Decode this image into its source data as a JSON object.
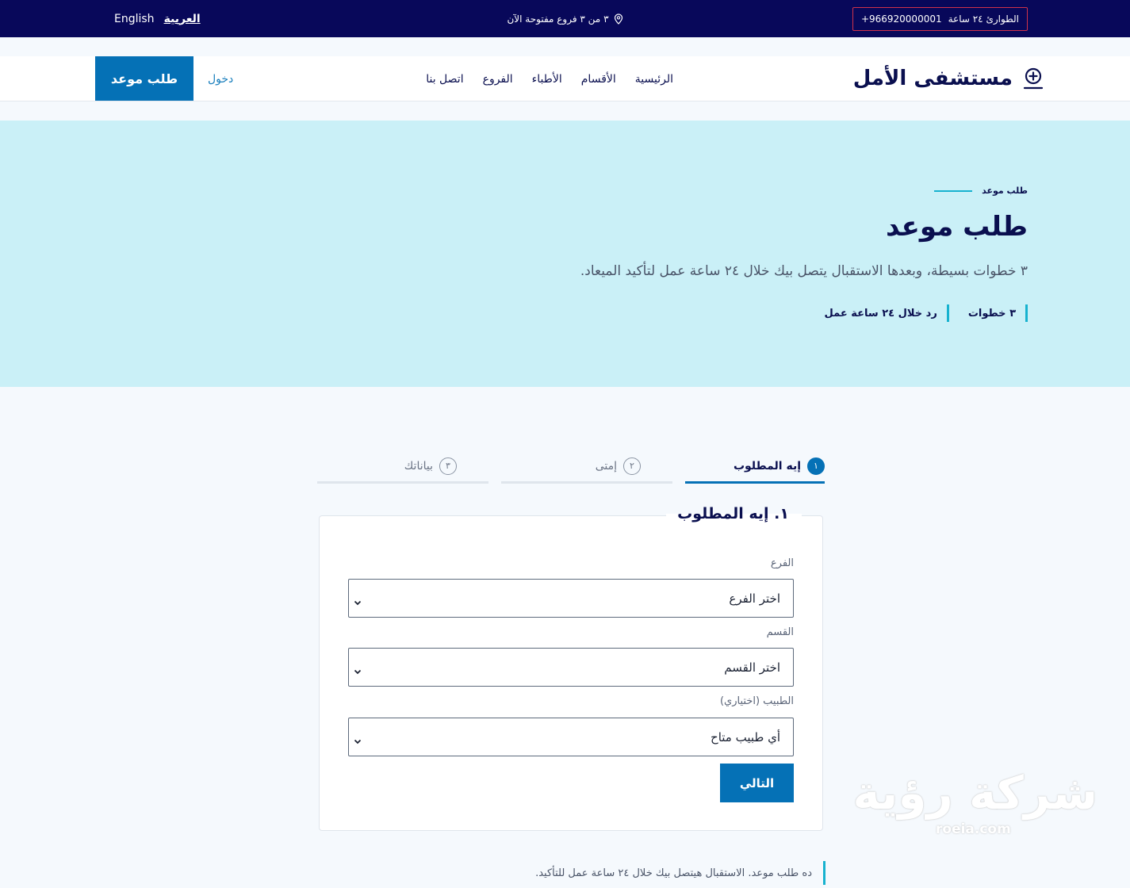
{
  "topbar": {
    "emergency_label": "الطوارئ ٢٤ ساعة",
    "emergency_phone": "+966920000001",
    "branches_status": "٣ من ٣ فروع مفتوحة الآن",
    "lang_en": "English",
    "lang_ar": "العربية"
  },
  "header": {
    "logo_name": "مستشفى الأمل",
    "nav": [
      "الرئيسية",
      "الأقسام",
      "الأطباء",
      "الفروع",
      "اتصل بنا"
    ],
    "login": "دخول",
    "book_button": "طلب موعد"
  },
  "hero": {
    "eyebrow": "طلب موعد",
    "title": "طلب موعد",
    "subtitle": "٣ خطوات بسيطة، وبعدها الاستقبال يتصل بيك خلال ٢٤ ساعة عمل لتأكيد الميعاد.",
    "stats": [
      "٣ خطوات",
      "رد خلال ٢٤ ساعة عمل"
    ]
  },
  "steps": [
    {
      "num": "١",
      "label": "إيه المطلوب",
      "active": true
    },
    {
      "num": "٢",
      "label": "إمتى",
      "active": false
    },
    {
      "num": "٣",
      "label": "بياناتك",
      "active": false
    }
  ],
  "form": {
    "legend": "١. إيه المطلوب",
    "branch_label": "الفرع",
    "branch_value": "اختر الفرع",
    "dept_label": "القسم",
    "dept_value": "اختر القسم",
    "doctor_label": "الطبيب (اختياري)",
    "doctor_value": "أي طبيب متاح",
    "next_button": "التالي"
  },
  "footnote": "ده طلب موعد. الاستقبال هيتصل بيك خلال ٢٤ ساعة عمل للتأكيد.",
  "watermark": {
    "text": "شركة رؤية",
    "url": "roeia.com"
  },
  "colors": {
    "topbar_bg": "#08085a",
    "primary": "#0571b6",
    "accent": "#17b2cf",
    "hero_bg": "#caf0f7",
    "emergency_border": "#d0324a"
  },
  "icons": {
    "location": "map-pin-icon",
    "logo": "plus-circle-person-icon",
    "select": "chevron-down-icon"
  }
}
